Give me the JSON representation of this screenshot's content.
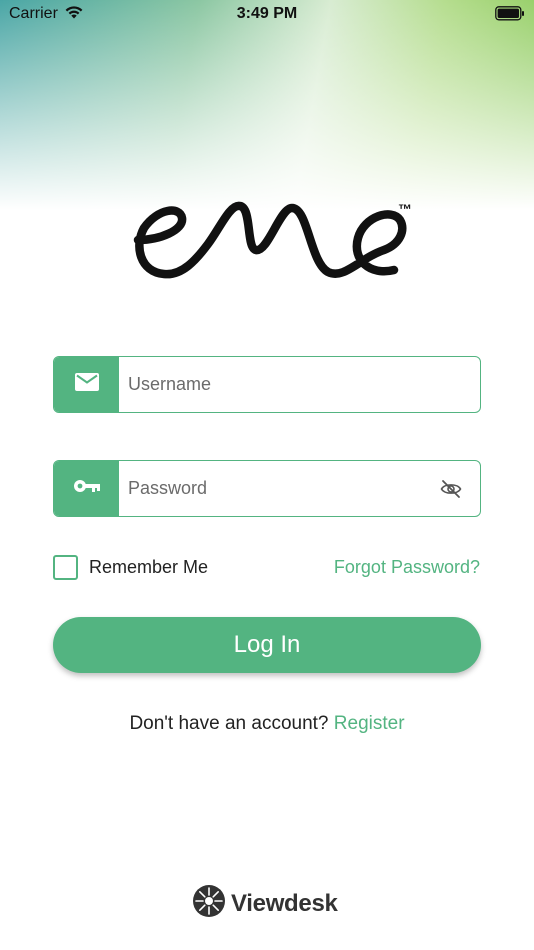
{
  "status_bar": {
    "carrier": "Carrier",
    "time": "3:49 PM",
    "icons": [
      "wifi-icon",
      "battery-icon"
    ]
  },
  "logo": {
    "name": "eme",
    "trademark": "™"
  },
  "form": {
    "username": {
      "placeholder": "Username",
      "value": "",
      "icon": "envelope-icon"
    },
    "password": {
      "placeholder": "Password",
      "value": "",
      "icon": "key-icon",
      "toggle_icon": "eye-slash-icon"
    },
    "remember_label": "Remember Me",
    "remember_checked": false,
    "forgot_label": "Forgot Password?",
    "login_label": "Log In"
  },
  "register": {
    "prompt": "Don't have an account?",
    "link_label": "Register"
  },
  "footer": {
    "brand_name": "Viewdesk"
  },
  "colors": {
    "accent": "#53b481",
    "text": "#222222"
  }
}
